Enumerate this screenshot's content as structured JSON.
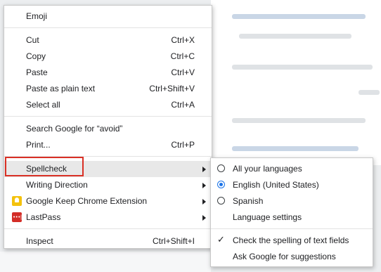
{
  "context_menu": {
    "items": [
      {
        "label": "Emoji"
      },
      {
        "label": "Cut",
        "shortcut": "Ctrl+X"
      },
      {
        "label": "Copy",
        "shortcut": "Ctrl+C"
      },
      {
        "label": "Paste",
        "shortcut": "Ctrl+V"
      },
      {
        "label": "Paste as plain text",
        "shortcut": "Ctrl+Shift+V"
      },
      {
        "label": "Select all",
        "shortcut": "Ctrl+A"
      },
      {
        "label": "Search Google for “avoid”"
      },
      {
        "label": "Print...",
        "shortcut": "Ctrl+P"
      },
      {
        "label": "Spellcheck"
      },
      {
        "label": "Writing Direction"
      },
      {
        "label": "Google Keep Chrome Extension",
        "icon": "google-keep-icon"
      },
      {
        "label": "LastPass",
        "icon": "lastpass-icon"
      },
      {
        "label": "Inspect",
        "shortcut": "Ctrl+Shift+I"
      }
    ]
  },
  "spellcheck_submenu": {
    "items": [
      {
        "label": "All your languages",
        "selected": false
      },
      {
        "label": "English (United States)",
        "selected": true
      },
      {
        "label": "Spanish",
        "selected": false
      },
      {
        "label": "Language settings"
      },
      {
        "label": "Check the spelling of text fields",
        "checked": true
      },
      {
        "label": "Ask Google for suggestions"
      }
    ]
  },
  "colors": {
    "highlight_box": "#d93025",
    "radio_selected": "#1a73e8",
    "hover_background": "#e8e8e8"
  }
}
